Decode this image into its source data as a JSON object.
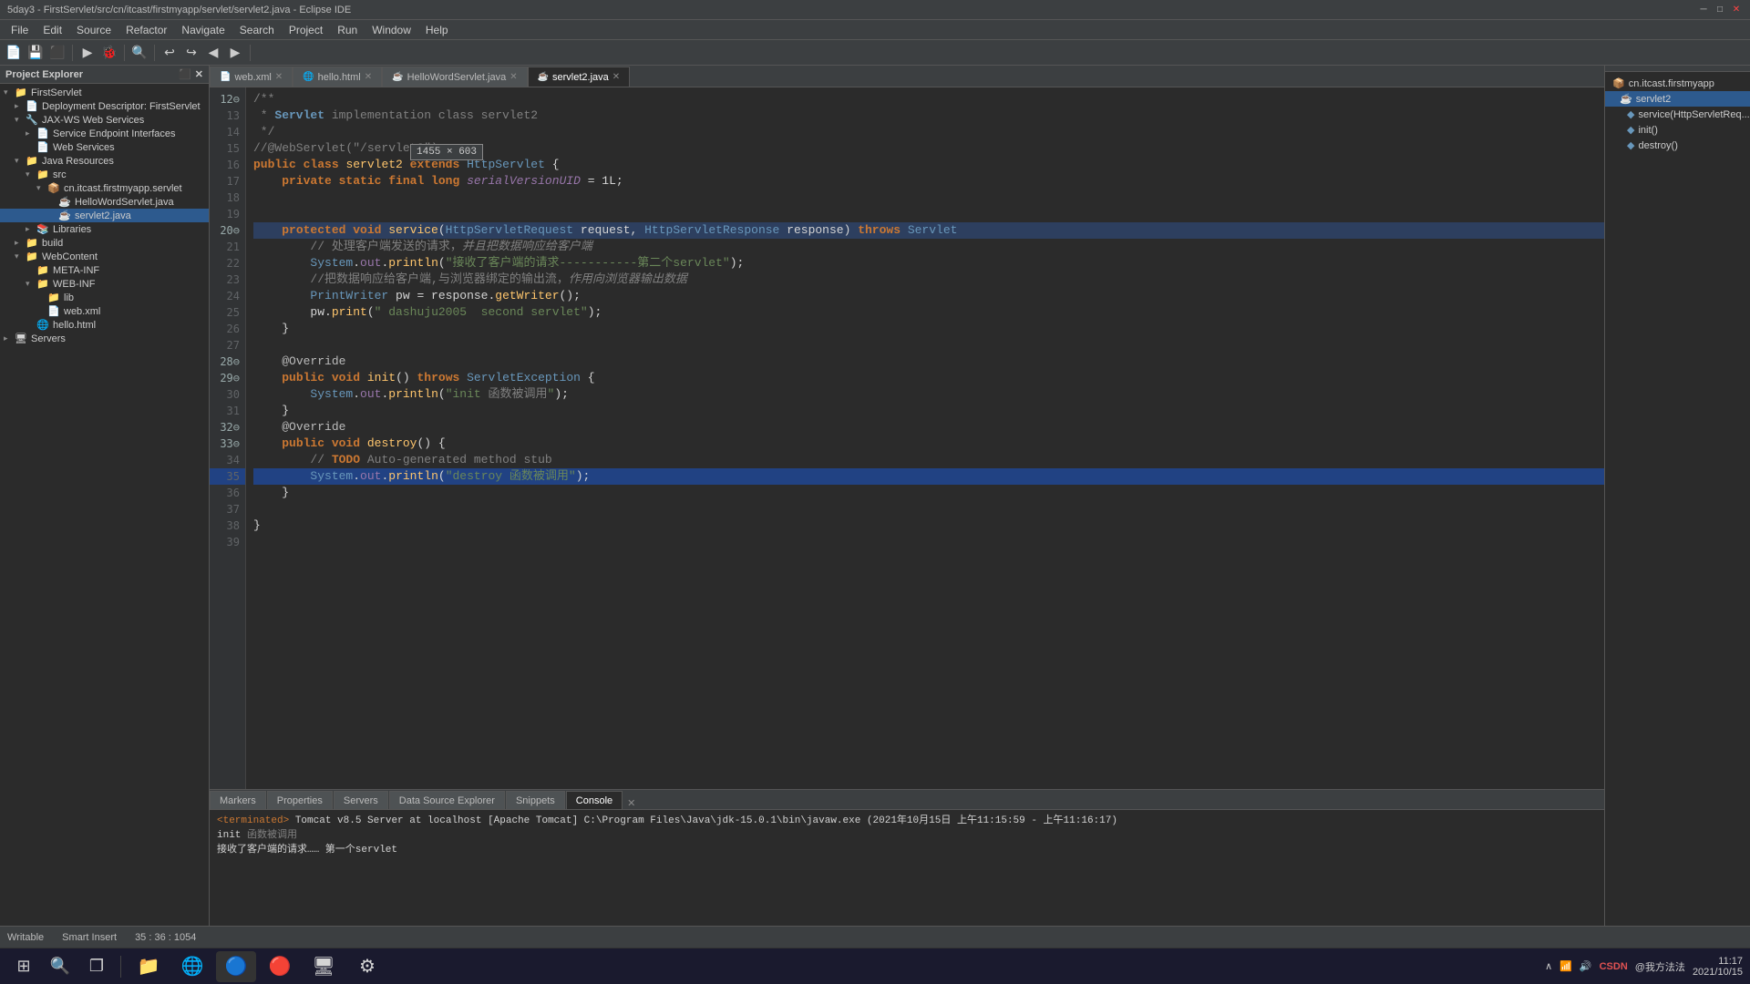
{
  "titleBar": {
    "title": "5day3 - FirstServlet/src/cn/itcast/firstmyapp/servlet/servlet2.java - Eclipse IDE",
    "minBtn": "─",
    "maxBtn": "□",
    "closeBtn": "✕"
  },
  "menuBar": {
    "items": [
      "File",
      "Edit",
      "Source",
      "Refactor",
      "Navigate",
      "Search",
      "Project",
      "Run",
      "Window",
      "Help"
    ]
  },
  "projectExplorer": {
    "title": "Project Explorer",
    "items": [
      {
        "label": "FirstServlet",
        "indent": 0,
        "arrow": "▾",
        "icon": "📁",
        "type": "folder"
      },
      {
        "label": "Deployment Descriptor: FirstServlet",
        "indent": 1,
        "arrow": "▸",
        "icon": "📄",
        "type": "file"
      },
      {
        "label": "JAX-WS Web Services",
        "indent": 1,
        "arrow": "▾",
        "icon": "🔧",
        "type": "folder"
      },
      {
        "label": "Service Endpoint Interfaces",
        "indent": 2,
        "arrow": "▸",
        "icon": "📄",
        "type": "file"
      },
      {
        "label": "Web Services",
        "indent": 2,
        "arrow": "",
        "icon": "📄",
        "type": "file"
      },
      {
        "label": "Java Resources",
        "indent": 1,
        "arrow": "▾",
        "icon": "📁",
        "type": "folder"
      },
      {
        "label": "src",
        "indent": 2,
        "arrow": "▾",
        "icon": "📁",
        "type": "folder"
      },
      {
        "label": "cn.itcast.firstmyapp.servlet",
        "indent": 3,
        "arrow": "▾",
        "icon": "📦",
        "type": "package"
      },
      {
        "label": "HelloWordServlet.java",
        "indent": 4,
        "arrow": "",
        "icon": "☕",
        "type": "java"
      },
      {
        "label": "servlet2.java",
        "indent": 4,
        "arrow": "",
        "icon": "☕",
        "type": "java",
        "selected": true
      },
      {
        "label": "Libraries",
        "indent": 2,
        "arrow": "▸",
        "icon": "📚",
        "type": "folder"
      },
      {
        "label": "build",
        "indent": 1,
        "arrow": "▸",
        "icon": "📁",
        "type": "folder"
      },
      {
        "label": "WebContent",
        "indent": 1,
        "arrow": "▾",
        "icon": "📁",
        "type": "folder"
      },
      {
        "label": "META-INF",
        "indent": 2,
        "arrow": "",
        "icon": "📁",
        "type": "folder"
      },
      {
        "label": "WEB-INF",
        "indent": 2,
        "arrow": "▾",
        "icon": "📁",
        "type": "folder"
      },
      {
        "label": "lib",
        "indent": 3,
        "arrow": "",
        "icon": "📁",
        "type": "folder"
      },
      {
        "label": "web.xml",
        "indent": 3,
        "arrow": "",
        "icon": "📄",
        "type": "file"
      },
      {
        "label": "hello.html",
        "indent": 2,
        "arrow": "",
        "icon": "🌐",
        "type": "html"
      },
      {
        "label": "Servers",
        "indent": 0,
        "arrow": "▸",
        "icon": "🖥",
        "type": "server"
      }
    ]
  },
  "editorTabs": [
    {
      "label": "web.xml",
      "icon": "📄",
      "active": false
    },
    {
      "label": "hello.html",
      "icon": "🌐",
      "active": false
    },
    {
      "label": "HelloWordServlet.java",
      "icon": "☕",
      "active": false
    },
    {
      "label": "servlet2.java",
      "icon": "☕",
      "active": true
    }
  ],
  "annotationBox": {
    "text": "1455 × 603"
  },
  "codeLines": [
    {
      "num": "12⊖",
      "code": "/**",
      "type": "comment"
    },
    {
      "num": "13",
      "code": " * Servlet implementation class servlet2",
      "type": "comment"
    },
    {
      "num": "14",
      "code": " */",
      "type": "comment"
    },
    {
      "num": "15",
      "code": "//@WebServlet(\"/servlet2\")",
      "type": "comment"
    },
    {
      "num": "16",
      "code": "public class servlet2 extends HttpServlet {",
      "type": "code"
    },
    {
      "num": "17",
      "code": "    private static final long serialVersionUID = 1L;",
      "type": "code"
    },
    {
      "num": "18",
      "code": "",
      "type": "code"
    },
    {
      "num": "19",
      "code": "",
      "type": "code"
    },
    {
      "num": "20⊖",
      "code": "    protected void service(HttpServletRequest request, HttpServletResponse response) throws Servlet",
      "type": "code",
      "highlight": true
    },
    {
      "num": "21",
      "code": "        // 处理客户端发送的请求，并且把数据响应给客户端",
      "type": "comment"
    },
    {
      "num": "22",
      "code": "        System.out.println(\"接收了客户端的请求-----------第二个servlet\");",
      "type": "code"
    },
    {
      "num": "23",
      "code": "        //把数据响应给客户端,与浏览器绑定的输出流，作用向浏览器输出数据",
      "type": "comment"
    },
    {
      "num": "24",
      "code": "        PrintWriter pw = response.getWriter();",
      "type": "code"
    },
    {
      "num": "25",
      "code": "        pw.print(\" dashuju2005  second servlet\");",
      "type": "code"
    },
    {
      "num": "26",
      "code": "    }",
      "type": "code"
    },
    {
      "num": "27",
      "code": "",
      "type": "code"
    },
    {
      "num": "28⊖",
      "code": "    @Override",
      "type": "code"
    },
    {
      "num": "29⊖",
      "code": "    public void init() throws ServletException {",
      "type": "code"
    },
    {
      "num": "30",
      "code": "        System.out.println(\"init 函数被调用\");",
      "type": "code"
    },
    {
      "num": "31",
      "code": "    }",
      "type": "code"
    },
    {
      "num": "32⊖",
      "code": "    @Override",
      "type": "code"
    },
    {
      "num": "33⊖",
      "code": "    public void destroy() {",
      "type": "code"
    },
    {
      "num": "34",
      "code": "        // TODO Auto-generated method stub",
      "type": "todo"
    },
    {
      "num": "35",
      "code": "        System.out.println(\"destroy 函数被调用\");",
      "type": "code",
      "selected": true
    },
    {
      "num": "36",
      "code": "    }",
      "type": "code"
    },
    {
      "num": "37",
      "code": "",
      "type": "code"
    },
    {
      "num": "38",
      "code": "}",
      "type": "code"
    },
    {
      "num": "39",
      "code": "",
      "type": "code"
    }
  ],
  "rightPanel": {
    "title": "",
    "items": [
      {
        "label": "cn.itcast.firstmyapp",
        "indent": 0,
        "icon": "📦"
      },
      {
        "label": "servlet2",
        "indent": 1,
        "icon": "☕",
        "selected": true
      },
      {
        "label": "service(HttpServletReq...",
        "indent": 2,
        "icon": "🔷"
      },
      {
        "label": "init()",
        "indent": 2,
        "icon": "🔷"
      },
      {
        "label": "destroy()",
        "indent": 2,
        "icon": "🔷"
      }
    ]
  },
  "bottomPanel": {
    "tabs": [
      "Markers",
      "Properties",
      "Servers",
      "Data Source Explorer",
      "Snippets",
      "Console"
    ],
    "activeTab": "Console",
    "consoleLines": [
      {
        "text": "<terminated> Tomcat v8.5 Server at localhost [Apache Tomcat] C:\\Program Files\\Java\\jdk-15.0.1\\bin\\javaw.exe  (2021年10月15日 上午11:15:59 - 上午11:16:17)"
      },
      {
        "text": "init 函数被调用"
      },
      {
        "text": "接收了客户端的请求……  第一个servlet"
      }
    ]
  },
  "statusBar": {
    "writableLabel": "Writable",
    "smartInsertLabel": "Smart Insert",
    "position": "35 : 36 : 1054"
  },
  "taskbar": {
    "startBtn": "⊞",
    "searchBtn": "🔍",
    "taskViewBtn": "❐",
    "apps": [
      "🗂",
      "📁",
      "📧",
      "💬",
      "🌐",
      "🔵"
    ],
    "sysTime": "11:17",
    "sysDate": "2021/10/15"
  }
}
